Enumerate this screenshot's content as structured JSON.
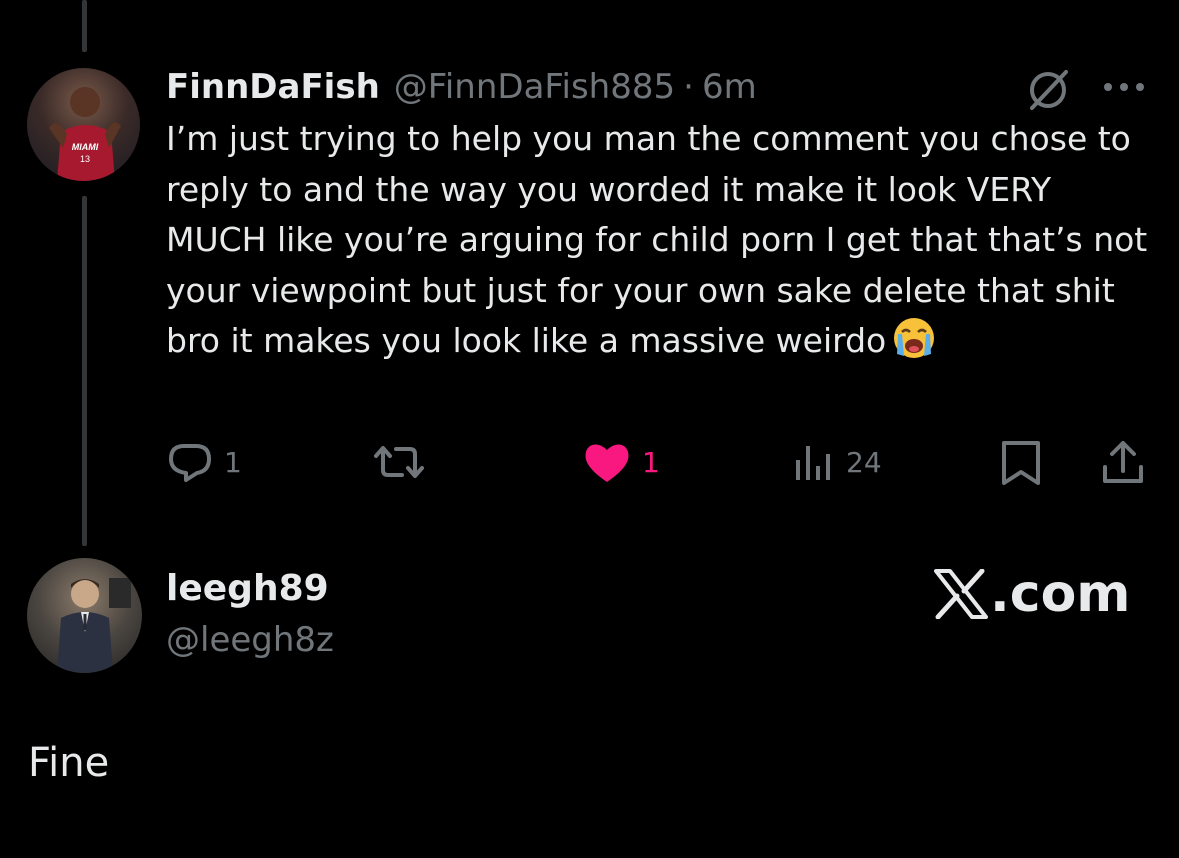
{
  "post": {
    "display_name": "FinnDaFish",
    "handle": "@FinnDaFish885",
    "separator": "·",
    "time": "6m",
    "text_before_emoji": "I’m just trying to help you man the comment you chose to reply to and the way you worded it make it look VERY MUCH like you’re arguing for child porn I get that that’s not your viewpoint but just for your own sake delete that shit bro it makes you look like a massive weirdo",
    "emoji": "loudly-crying-face",
    "actions": {
      "reply_count": "1",
      "like_count": "1",
      "view_count": "24"
    },
    "like_color": "#f91880"
  },
  "user2": {
    "display_name": "leegh89",
    "handle": "@leegh8z"
  },
  "watermark": {
    "text": ".com"
  },
  "reply": {
    "text": "Fine"
  },
  "colors": {
    "background": "#000000",
    "primary_text": "#e7e9ea",
    "secondary_text": "#71767b"
  }
}
